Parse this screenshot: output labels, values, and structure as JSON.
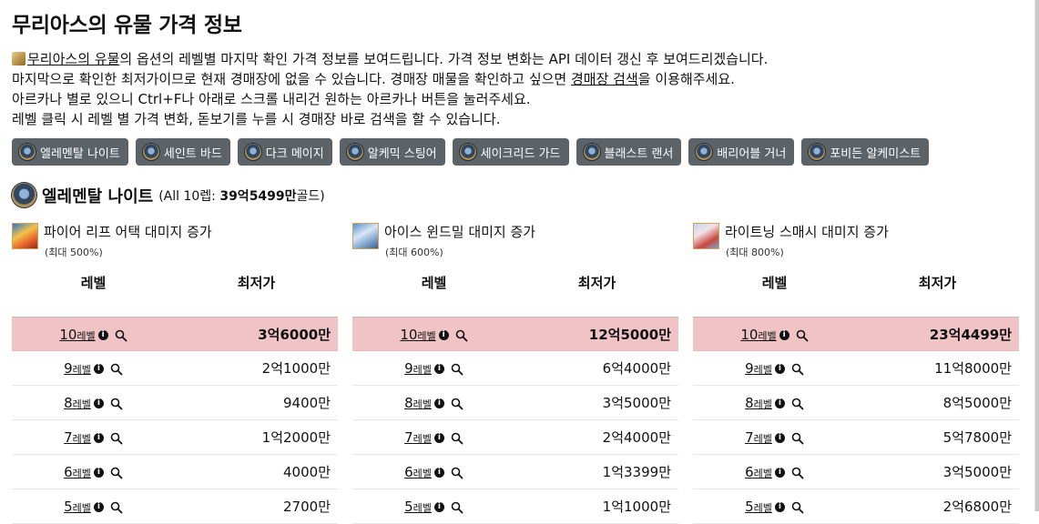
{
  "page": {
    "title": "무리아스의 유물 가격 정보",
    "desc_line1_link": "무리아스의 유물",
    "desc_line1_rest": "의 옵션의 레벨별 마지막 확인 가격 정보를 보여드립니다. 가격 정보 변화는 API 데이터 갱신 후 보여드리겠습니다.",
    "desc_line2_pre": "마지막으로 확인한 최저가이므로 현재 경매장에 없을 수 있습니다. 경매장 매물을 확인하고 싶으면 ",
    "desc_line2_link": "경매장 검색",
    "desc_line2_post": "을 이용해주세요.",
    "desc_line3": "아르카나 별로 있으니 Ctrl+F나 아래로 스크롤 내리건 원하는 아르카나 버튼을 눌러주세요.",
    "desc_line4": "레벨 클릭 시 레벨 별 가격 변화, 돋보기를 누를 시 경매장 바로 검색을 할 수 있습니다."
  },
  "class_buttons": [
    "엘레멘탈 나이트",
    "세인트 바드",
    "다크 메이지",
    "알케믹 스팅어",
    "세이크리드 가드",
    "블래스트 랜서",
    "배리어블 거너",
    "포비든 알케미스트"
  ],
  "section": {
    "title": "엘레멘탈 나이트",
    "meta_open": "(All 10렙: ",
    "meta_value": "39억5499만",
    "meta_close": "골드)"
  },
  "table_headers": {
    "level": "레벨",
    "price": "최저가"
  },
  "level_unit": "레벨",
  "options": [
    {
      "icon": "fire-leap-skill-icon",
      "name": "파이어 리프 어택 대미지 증가",
      "max": "(최대 500%)",
      "rows": [
        {
          "level": "10",
          "price": "3억6000만"
        },
        {
          "level": "9",
          "price": "2억1000만"
        },
        {
          "level": "8",
          "price": "9400만"
        },
        {
          "level": "7",
          "price": "1억2000만"
        },
        {
          "level": "6",
          "price": "4000만"
        },
        {
          "level": "5",
          "price": "2700만"
        }
      ]
    },
    {
      "icon": "ice-windmill-skill-icon",
      "name": "아이스 윈드밀 대미지 증가",
      "max": "(최대 600%)",
      "rows": [
        {
          "level": "10",
          "price": "12억5000만"
        },
        {
          "level": "9",
          "price": "6억4000만"
        },
        {
          "level": "8",
          "price": "3억5000만"
        },
        {
          "level": "7",
          "price": "2억4000만"
        },
        {
          "level": "6",
          "price": "1억3399만"
        },
        {
          "level": "5",
          "price": "1억1000만"
        }
      ]
    },
    {
      "icon": "lightning-smash-skill-icon",
      "name": "라이트닝 스매시 대미지 증가",
      "max": "(최대 800%)",
      "rows": [
        {
          "level": "10",
          "price": "23억4499만"
        },
        {
          "level": "9",
          "price": "11억8000만"
        },
        {
          "level": "8",
          "price": "8억5000만"
        },
        {
          "level": "7",
          "price": "5억7800만"
        },
        {
          "level": "6",
          "price": "3억5000만"
        },
        {
          "level": "5",
          "price": "2억6800만"
        }
      ]
    }
  ]
}
